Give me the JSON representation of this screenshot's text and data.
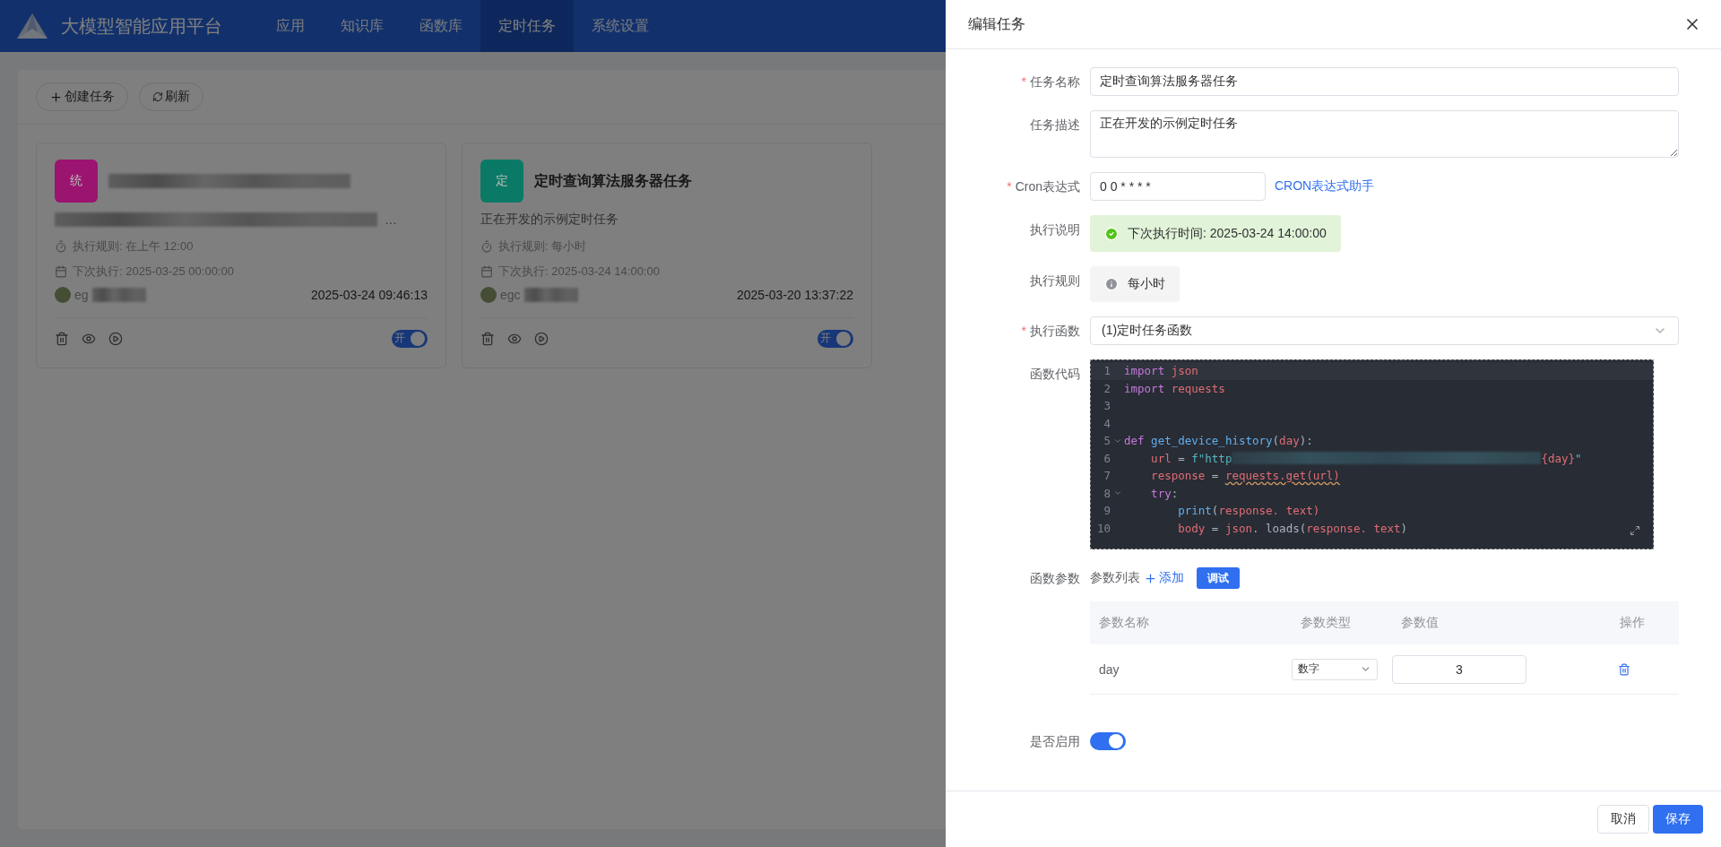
{
  "app": {
    "title": "大模型智能应用平台",
    "nav": [
      {
        "label": "应用",
        "selected": false
      },
      {
        "label": "知识库",
        "selected": false
      },
      {
        "label": "函数库",
        "selected": false
      },
      {
        "label": "定时任务",
        "selected": true
      },
      {
        "label": "系统设置",
        "selected": false
      }
    ]
  },
  "toolbar": {
    "buttons": [
      {
        "label": "创建任务"
      },
      {
        "label": "刷新"
      }
    ]
  },
  "tasks": [
    {
      "badge": "统",
      "color": "#9b1470",
      "title_blurred": true,
      "description_blurred": true,
      "description_suffix": "…",
      "rule": "执行规则: 在上午 12:00",
      "next": "下次执行: 2025-03-25 00:00:00",
      "user": "eg",
      "created": "2025-03-24 09:46:13",
      "enabled": true,
      "toggle_label": "开"
    },
    {
      "badge": "定",
      "color": "#0a7a66",
      "title": "定时查询算法服务器任务",
      "description": "正在开发的示例定时任务",
      "rule": "执行规则: 每小时",
      "next": "下次执行: 2025-03-24 14:00:00",
      "user": "egc",
      "created": "2025-03-20 13:37:22",
      "enabled": true,
      "toggle_label": "开"
    }
  ],
  "drawer": {
    "title": "编辑任务",
    "required_mark": "*",
    "fields": [
      {
        "kind": "input",
        "label": "任务名称",
        "required": true,
        "value": "定时查询算法服务器任务"
      },
      {
        "kind": "textarea",
        "label": "任务描述",
        "required": false,
        "value": "正在开发的示例定时任务"
      },
      {
        "kind": "cron",
        "label": "Cron表达式",
        "required": true,
        "value": "0 0 * * * *",
        "link": "CRON表达式助手"
      },
      {
        "kind": "success",
        "label": "执行说明",
        "required": false,
        "text": "下次执行时间: 2025-03-24 14:00:00"
      },
      {
        "kind": "info",
        "label": "执行规则",
        "required": false,
        "text": "每小时"
      },
      {
        "kind": "select",
        "label": "执行函数",
        "required": true,
        "value": "(1)定时任务函数"
      },
      {
        "kind": "code",
        "label": "函数代码",
        "required": false,
        "lines": [
          {
            "n": "1",
            "fold": false,
            "tokens": [
              {
                "text": "import",
                "kind": "keyword"
              },
              {
                "text": " json",
                "kind": "variable"
              }
            ]
          },
          {
            "n": "2",
            "fold": false,
            "tokens": [
              {
                "text": "import",
                "kind": "keyword"
              },
              {
                "text": " requests",
                "kind": "variable"
              }
            ]
          },
          {
            "n": "3",
            "fold": false
          },
          {
            "n": "4",
            "fold": false
          },
          {
            "n": "5",
            "fold": true,
            "tokens": [
              {
                "text": "def",
                "kind": "keyword"
              },
              {
                "text": " get_device_history",
                "kind": "function"
              },
              {
                "text": "(",
                "kind": "punct"
              },
              {
                "text": "day",
                "kind": "variable"
              },
              {
                "text": "):",
                "kind": "punct"
              }
            ]
          },
          {
            "n": "6",
            "fold": false,
            "tokens": [
              {
                "text": "    url",
                "kind": "variable"
              },
              {
                "text": " = ",
                "kind": "punct"
              },
              {
                "text": "f\"http",
                "kind": "string"
              },
              {
                "kind": "blur"
              },
              {
                "text": "{day}",
                "kind": "variable"
              },
              {
                "text": "\"",
                "kind": "string"
              }
            ]
          },
          {
            "n": "7",
            "fold": false,
            "tokens": [
              {
                "text": "    response",
                "kind": "variable"
              },
              {
                "text": " = ",
                "kind": "punct"
              },
              {
                "text": "requests.get(url)",
                "kind": "warning"
              }
            ]
          },
          {
            "n": "8",
            "fold": true,
            "tokens": [
              {
                "text": "    try",
                "kind": "keyword"
              },
              {
                "text": ":",
                "kind": "punct"
              }
            ]
          },
          {
            "n": "9",
            "fold": false,
            "tokens": [
              {
                "text": "        print",
                "kind": "function"
              },
              {
                "text": "(",
                "kind": "punct"
              },
              {
                "text": "response",
                "kind": "variable"
              },
              {
                "text": ". text)",
                "kind": "variable"
              }
            ]
          },
          {
            "n": "10",
            "fold": false,
            "tokens": [
              {
                "text": "        body",
                "kind": "variable"
              },
              {
                "text": " = ",
                "kind": "punct"
              },
              {
                "text": "json",
                "kind": "variable"
              },
              {
                "text": ". loads",
                "kind": "punct"
              },
              {
                "text": "(",
                "kind": "punct"
              },
              {
                "text": "response",
                "kind": "variable"
              },
              {
                "text": ". text",
                "kind": "variable"
              },
              {
                "text": ")",
                "kind": "punct"
              }
            ]
          }
        ]
      },
      {
        "kind": "params",
        "label": "函数参数",
        "required": false,
        "list_label": "参数列表",
        "add": "添加",
        "debug": "调试",
        "columns": [
          "参数名称",
          "参数类型",
          "参数值",
          "操作"
        ],
        "rows": [
          {
            "name": "day",
            "type": "数字",
            "value": "3"
          }
        ]
      },
      {
        "kind": "switch",
        "label": "是否启用",
        "required": false,
        "on": true
      }
    ],
    "footer": {
      "cancel": "取消",
      "save": "保存"
    }
  }
}
